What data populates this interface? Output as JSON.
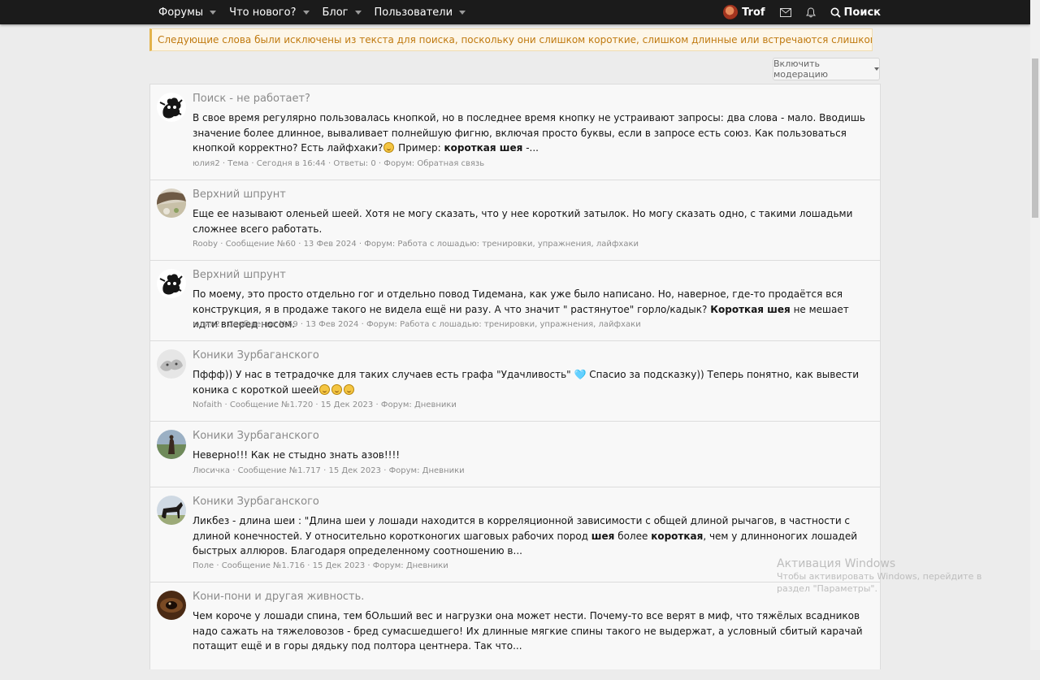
{
  "nav": {
    "items": [
      "Форумы",
      "Что нового?",
      "Блог",
      "Пользователи"
    ],
    "username": "Trof",
    "search_label": "Поиск"
  },
  "notice": "Следующие слова были исключены из текста для поиска, поскольку они слишком короткие, слишком длинные или встречаются слишком часто: шея",
  "moderation_button": "Включить модерацию",
  "results": [
    {
      "title": "Поиск - не работает?",
      "snippet_parts": [
        {
          "t": "В свое время регулярно пользовалась кнопкой, но в последнее время кнопку не устраивают запросы: два слова - мало. Вводишь значение более длинное, вываливает полнейшую фигню, включая просто буквы, если в запросе есть союз. Как пользоваться кнопкой корректно? Есть лайфхаки?"
        },
        {
          "emoji": "confused"
        },
        {
          "t": " Пример: "
        },
        {
          "t": "короткая шея",
          "b": true
        },
        {
          "t": " -..."
        }
      ],
      "meta": {
        "author": "юлия2",
        "type": "Тема",
        "date": "Сегодня в 16:44",
        "extra": "Ответы: 0",
        "forum_label": "Форум:",
        "forum": "Обратная связь"
      }
    },
    {
      "title": "Верхний шпрунт",
      "snippet_parts": [
        {
          "t": "Еще ее называют оленьей шеей. Хотя не могу сказать, что у нее короткий затылок. Но могу сказать одно, с такими лошадьми сложнее всего работать."
        }
      ],
      "meta": {
        "author": "Rooby",
        "type": "Сообщение №60",
        "date": "13 Фев 2024",
        "extra": "",
        "forum_label": "Форум:",
        "forum": "Работа с лошадью: тренировки, упражнения, лайфхаки"
      }
    },
    {
      "title": "Верхний шпрунт",
      "snippet_parts": [
        {
          "t": "По моему, это просто отдельно гог и отдельно повод Тидемана, как уже было написано. Но, наверное, где-то продаётся вся конструкция, я в продаже такого не видела ещё ни разу. А что значит \" растянутое\" горло/кадык? "
        },
        {
          "t": "Короткая шея",
          "b": true
        },
        {
          "t": " не мешает идти вперед носом."
        }
      ],
      "meta": {
        "author": "юлия2",
        "type": "Сообщение №59",
        "date": "13 Фев 2024",
        "extra": "",
        "forum_label": "Форум:",
        "forum": "Работа с лошадью: тренировки, упражнения, лайфхаки"
      }
    },
    {
      "title": "Коники Зурбаганского",
      "snippet_parts": [
        {
          "t": "Пффф)) У нас в тетрадочке для таких случаев есть графа \"Удачливость\" 🩵 Спасио за подсказку)) Теперь понятно, как вывести коника с короткой шеей"
        },
        {
          "emoji": "rofl"
        },
        {
          "emoji": "rofl"
        },
        {
          "emoji": "rofl"
        }
      ],
      "meta": {
        "author": "Nofaith",
        "type": "Сообщение №1.720",
        "date": "15 Дек 2023",
        "extra": "",
        "forum_label": "Форум:",
        "forum": "Дневники"
      }
    },
    {
      "title": "Коники Зурбаганского",
      "snippet_parts": [
        {
          "t": "Неверно!!! Как не стыдно знать азов!!!!"
        }
      ],
      "meta": {
        "author": "Люсичка",
        "type": "Сообщение №1.717",
        "date": "15 Дек 2023",
        "extra": "",
        "forum_label": "Форум:",
        "forum": "Дневники"
      }
    },
    {
      "title": "Коники Зурбаганского",
      "snippet_parts": [
        {
          "t": "Ликбез - длина шеи : \"Длина шеи у лошади находится в корреляционной зависимости с общей длиной рычагов, в частности с длиной конечностей. У относительно коротконогих шаговых рабочих пород "
        },
        {
          "t": "шея",
          "b": true
        },
        {
          "t": " более "
        },
        {
          "t": "короткая",
          "b": true
        },
        {
          "t": ", чем у длинноногих лошадей быстрых аллюров. Благодаря определенному соотношению в..."
        }
      ],
      "meta": {
        "author": "Поле",
        "type": "Сообщение №1.716",
        "date": "15 Дек 2023",
        "extra": "",
        "forum_label": "Форум:",
        "forum": "Дневники"
      }
    },
    {
      "title": "Кони-пони и другая живность.",
      "snippet_parts": [
        {
          "t": "Чем короче у лошади спина, тем бОльший вес и нагрузки она может нести. Почему-то все верят в миф, что тяжёлых всадников надо сажать на тяжеловозов - бред сумасшедшего! Их длинные мягкие спины такого не выдержат, а условный сбитый карачай потащит ещё и в горы дядьку под полтора центнера. Так что..."
        }
      ],
      "meta": {
        "author": "",
        "type": "",
        "date": "",
        "extra": "",
        "forum_label": "",
        "forum": ""
      }
    }
  ],
  "watermark": {
    "title": "Активация Windows",
    "subtitle": "Чтобы активировать Windows, перейдите в раздел \"Параметры\"."
  }
}
